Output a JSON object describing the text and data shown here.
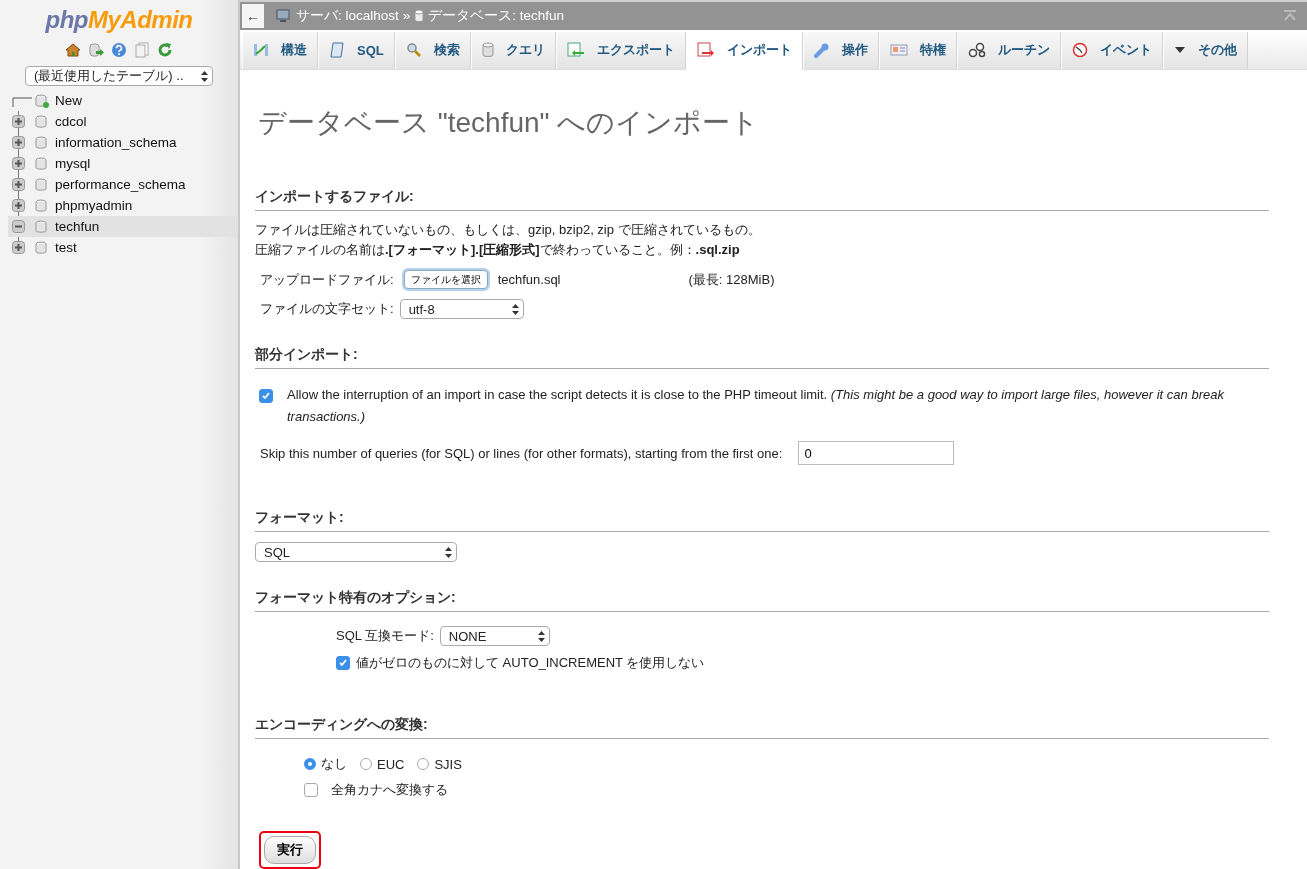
{
  "logo": {
    "part1": "php",
    "part2": "MyAdmin"
  },
  "sidebar": {
    "recent_select": "(最近使用したテーブル) ..",
    "tree": [
      {
        "label": "New",
        "kind": "new",
        "selected": false
      },
      {
        "label": "cdcol",
        "kind": "db",
        "expanded": false,
        "selected": false
      },
      {
        "label": "information_schema",
        "kind": "db",
        "expanded": false,
        "selected": false
      },
      {
        "label": "mysql",
        "kind": "db",
        "expanded": false,
        "selected": false
      },
      {
        "label": "performance_schema",
        "kind": "db",
        "expanded": false,
        "selected": false
      },
      {
        "label": "phpmyadmin",
        "kind": "db",
        "expanded": false,
        "selected": false
      },
      {
        "label": "techfun",
        "kind": "db",
        "expanded": true,
        "selected": true
      },
      {
        "label": "test",
        "kind": "db",
        "expanded": false,
        "selected": false
      }
    ]
  },
  "breadcrumb": {
    "back": "←",
    "server": "サーバ: localhost",
    "separator": "»",
    "database": "データベース: techfun"
  },
  "tabs": [
    {
      "label": "構造",
      "selected": false
    },
    {
      "label": "SQL",
      "selected": false
    },
    {
      "label": "検索",
      "selected": false
    },
    {
      "label": "クエリ",
      "selected": false
    },
    {
      "label": "エクスポート",
      "selected": false
    },
    {
      "label": "インポート",
      "selected": true
    },
    {
      "label": "操作",
      "selected": false
    },
    {
      "label": "特権",
      "selected": false
    },
    {
      "label": "ルーチン",
      "selected": false
    },
    {
      "label": "イベント",
      "selected": false
    },
    {
      "label": "その他",
      "selected": false
    }
  ],
  "page_title": "データベース \"techfun\" へのインポート",
  "file_section": {
    "heading": "インポートするファイル:",
    "description": [
      "ファイルは圧縮されていないもの、もしくは、gzip, bzip2, zip で圧縮されているもの。",
      "圧縮ファイルの名前は**.[フォーマット].[圧縮形式]**で終わっていること。例：**.sql.zip**"
    ],
    "upload_label": "アップロードファイル:",
    "choose_button": "ファイルを選択",
    "file_name": "techfun.sql",
    "max_size": "(最長: 128MiB)",
    "charset_label": "ファイルの文字セット:",
    "charset_value": "utf-8"
  },
  "partial_section": {
    "heading": "部分インポート:",
    "allow_interrupt": {
      "checked": true,
      "text": "Allow the interruption of an import in case the script detects it is close to the PHP timeout limit. *(This might be a good way to import large files, however it can break transactions.)*"
    },
    "skip_label": "Skip this number of queries (for SQL) or lines (for other formats), starting from the first one:",
    "skip_value": "0"
  },
  "format_section": {
    "heading": "フォーマット:",
    "format_value": "SQL"
  },
  "options_section": {
    "heading": "フォーマット特有のオプション:",
    "compat_label": "SQL 互換モード:",
    "compat_value": "NONE",
    "no_auto_value": {
      "checked": true,
      "text": "値がゼロのものに対して AUTO_INCREMENT を使用しない"
    }
  },
  "encoding_section": {
    "heading": "エンコーディングへの変換:",
    "radios": [
      {
        "label": "なし",
        "selected": true
      },
      {
        "label": "EUC",
        "selected": false
      },
      {
        "label": "SJIS",
        "selected": false
      }
    ],
    "kana": {
      "checked": false,
      "text": "全角カナへ変換する"
    }
  },
  "submit": {
    "label": "実行",
    "highlighted": true
  }
}
